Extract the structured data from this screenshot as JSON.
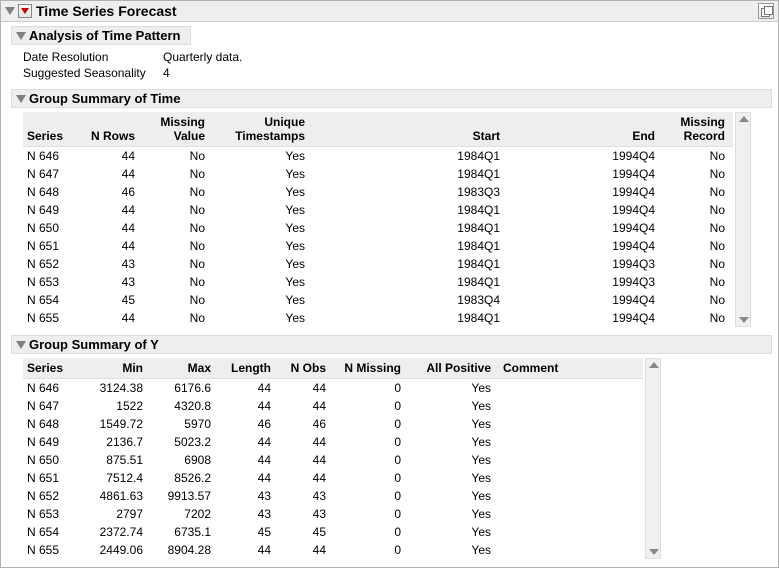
{
  "title": "Time Series Forecast",
  "analysis": {
    "header": "Analysis of Time Pattern",
    "date_res_label": "Date Resolution",
    "date_res_value": "Quarterly data.",
    "seasonality_label": "Suggested Seasonality",
    "seasonality_value": "4"
  },
  "time_summary": {
    "header": "Group Summary of Time",
    "cols": {
      "series": "Series",
      "nrows": "N Rows",
      "missing_value": "Missing Value",
      "unique_ts": "Unique Timestamps",
      "start": "Start",
      "end": "End",
      "missing_record": "Missing Record"
    },
    "rows": [
      {
        "series": "N 646",
        "nrows": "44",
        "mv": "No",
        "uts": "Yes",
        "start": "1984Q1",
        "end": "1994Q4",
        "mr": "No"
      },
      {
        "series": "N 647",
        "nrows": "44",
        "mv": "No",
        "uts": "Yes",
        "start": "1984Q1",
        "end": "1994Q4",
        "mr": "No"
      },
      {
        "series": "N 648",
        "nrows": "46",
        "mv": "No",
        "uts": "Yes",
        "start": "1983Q3",
        "end": "1994Q4",
        "mr": "No"
      },
      {
        "series": "N 649",
        "nrows": "44",
        "mv": "No",
        "uts": "Yes",
        "start": "1984Q1",
        "end": "1994Q4",
        "mr": "No"
      },
      {
        "series": "N 650",
        "nrows": "44",
        "mv": "No",
        "uts": "Yes",
        "start": "1984Q1",
        "end": "1994Q4",
        "mr": "No"
      },
      {
        "series": "N 651",
        "nrows": "44",
        "mv": "No",
        "uts": "Yes",
        "start": "1984Q1",
        "end": "1994Q4",
        "mr": "No"
      },
      {
        "series": "N 652",
        "nrows": "43",
        "mv": "No",
        "uts": "Yes",
        "start": "1984Q1",
        "end": "1994Q3",
        "mr": "No"
      },
      {
        "series": "N 653",
        "nrows": "43",
        "mv": "No",
        "uts": "Yes",
        "start": "1984Q1",
        "end": "1994Q3",
        "mr": "No"
      },
      {
        "series": "N 654",
        "nrows": "45",
        "mv": "No",
        "uts": "Yes",
        "start": "1983Q4",
        "end": "1994Q4",
        "mr": "No"
      },
      {
        "series": "N 655",
        "nrows": "44",
        "mv": "No",
        "uts": "Yes",
        "start": "1984Q1",
        "end": "1994Q4",
        "mr": "No"
      }
    ]
  },
  "y_summary": {
    "header": "Group Summary of Y",
    "cols": {
      "series": "Series",
      "min": "Min",
      "max": "Max",
      "length": "Length",
      "nobs": "N Obs",
      "nmiss": "N Missing",
      "allpos": "All Positive",
      "comment": "Comment"
    },
    "rows": [
      {
        "series": "N 646",
        "min": "3124.38",
        "max": "6176.6",
        "len": "44",
        "nobs": "44",
        "nmiss": "0",
        "ap": "Yes",
        "c": ""
      },
      {
        "series": "N 647",
        "min": "1522",
        "max": "4320.8",
        "len": "44",
        "nobs": "44",
        "nmiss": "0",
        "ap": "Yes",
        "c": ""
      },
      {
        "series": "N 648",
        "min": "1549.72",
        "max": "5970",
        "len": "46",
        "nobs": "46",
        "nmiss": "0",
        "ap": "Yes",
        "c": ""
      },
      {
        "series": "N 649",
        "min": "2136.7",
        "max": "5023.2",
        "len": "44",
        "nobs": "44",
        "nmiss": "0",
        "ap": "Yes",
        "c": ""
      },
      {
        "series": "N 650",
        "min": "875.51",
        "max": "6908",
        "len": "44",
        "nobs": "44",
        "nmiss": "0",
        "ap": "Yes",
        "c": ""
      },
      {
        "series": "N 651",
        "min": "7512.4",
        "max": "8526.2",
        "len": "44",
        "nobs": "44",
        "nmiss": "0",
        "ap": "Yes",
        "c": ""
      },
      {
        "series": "N 652",
        "min": "4861.63",
        "max": "9913.57",
        "len": "43",
        "nobs": "43",
        "nmiss": "0",
        "ap": "Yes",
        "c": ""
      },
      {
        "series": "N 653",
        "min": "2797",
        "max": "7202",
        "len": "43",
        "nobs": "43",
        "nmiss": "0",
        "ap": "Yes",
        "c": ""
      },
      {
        "series": "N 654",
        "min": "2372.74",
        "max": "6735.1",
        "len": "45",
        "nobs": "45",
        "nmiss": "0",
        "ap": "Yes",
        "c": ""
      },
      {
        "series": "N 655",
        "min": "2449.06",
        "max": "8904.28",
        "len": "44",
        "nobs": "44",
        "nmiss": "0",
        "ap": "Yes",
        "c": ""
      }
    ]
  }
}
